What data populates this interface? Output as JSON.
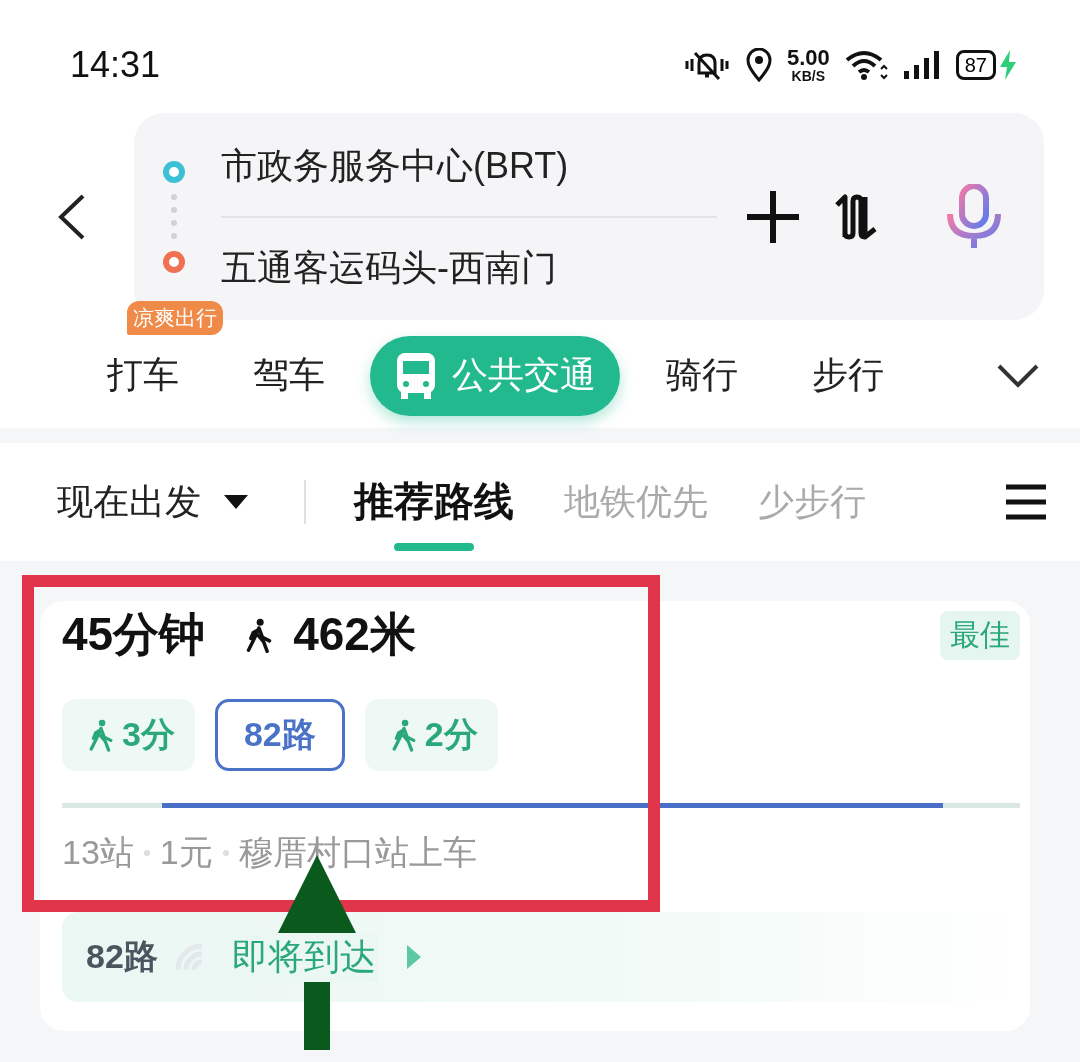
{
  "status_bar": {
    "time": "14:31",
    "speed_value": "5.00",
    "speed_unit": "KB/S",
    "battery": "87",
    "charging": true
  },
  "search": {
    "origin": "市政务服务中心(BRT)",
    "destination": "五通客运码头-西南门"
  },
  "modes": [
    {
      "label": "打车",
      "selected": false,
      "badge": "凉爽出行"
    },
    {
      "label": "驾车",
      "selected": false
    },
    {
      "label": "公共交通",
      "selected": true
    },
    {
      "label": "骑行",
      "selected": false
    },
    {
      "label": "步行",
      "selected": false
    }
  ],
  "departure": "现在出发",
  "route_tabs": [
    {
      "label": "推荐路线",
      "selected": true
    },
    {
      "label": "地铁优先",
      "selected": false
    },
    {
      "label": "少步行",
      "selected": false
    }
  ],
  "route": {
    "duration": "45分钟",
    "walk_distance": "462米",
    "badge": "最佳",
    "segments": [
      {
        "kind": "walk",
        "label": "3分"
      },
      {
        "kind": "bus",
        "label": "82路"
      },
      {
        "kind": "walk",
        "label": "2分"
      }
    ],
    "summary": [
      "13站",
      "1元",
      "穆厝村口站上车"
    ],
    "arrival": {
      "line": "82路",
      "status": "即将到达"
    }
  },
  "annotations": [
    {
      "kind": "frame"
    },
    {
      "kind": "arrow"
    }
  ]
}
